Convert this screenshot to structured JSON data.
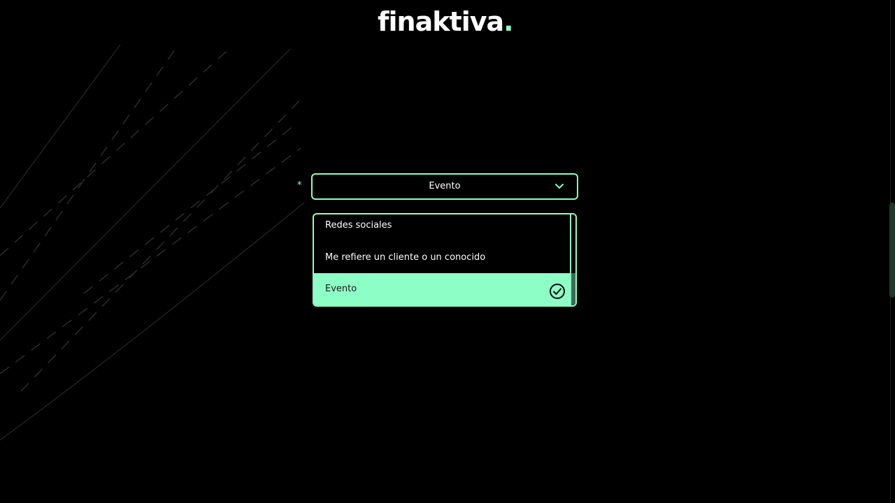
{
  "brand": {
    "name": "finaktiva",
    "dot": ".",
    "accent_color": "#8cfec6"
  },
  "form": {
    "required_mark": "*",
    "select": {
      "value": "Evento",
      "icon": "chevron-down-icon"
    },
    "options": [
      {
        "label": "Redes sociales",
        "selected": false
      },
      {
        "label": "Me refiere un cliente o un conocido",
        "selected": false
      },
      {
        "label": "Evento",
        "selected": true
      }
    ],
    "selected_icon": "check-circle-icon"
  }
}
